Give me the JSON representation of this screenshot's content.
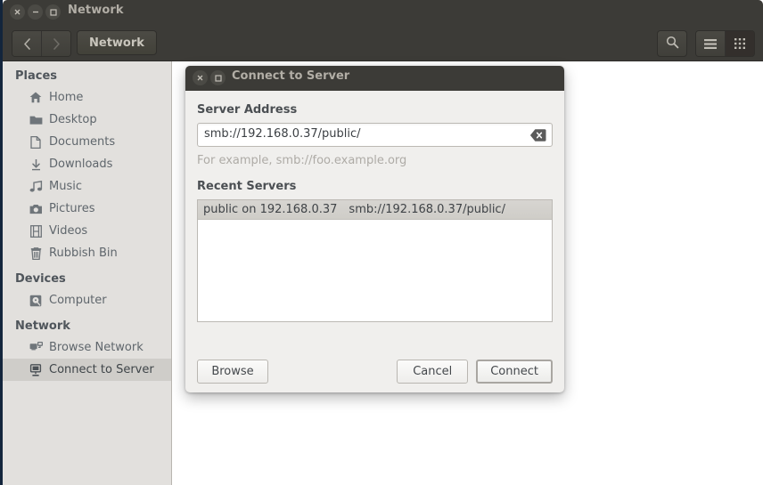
{
  "window": {
    "title": "Network",
    "controls": [
      {
        "name": "close",
        "glyph": "close-icon"
      },
      {
        "name": "minimize",
        "glyph": "minimize-icon"
      },
      {
        "name": "maximize",
        "glyph": "maximize-icon"
      }
    ]
  },
  "toolbar": {
    "back_label": "Back",
    "forward_label": "Forward",
    "breadcrumb": "Network",
    "search_label": "Search",
    "list_view_label": "List view",
    "grid_view_label": "Icon view"
  },
  "sidebar": {
    "sections": [
      {
        "heading": "Places",
        "items": [
          {
            "label": "Home",
            "icon": "home-icon",
            "selected": false
          },
          {
            "label": "Desktop",
            "icon": "folder-icon",
            "selected": false
          },
          {
            "label": "Documents",
            "icon": "document-icon",
            "selected": false
          },
          {
            "label": "Downloads",
            "icon": "download-icon",
            "selected": false
          },
          {
            "label": "Music",
            "icon": "music-icon",
            "selected": false
          },
          {
            "label": "Pictures",
            "icon": "camera-icon",
            "selected": false
          },
          {
            "label": "Videos",
            "icon": "film-icon",
            "selected": false
          },
          {
            "label": "Rubbish Bin",
            "icon": "trash-icon",
            "selected": false
          }
        ]
      },
      {
        "heading": "Devices",
        "items": [
          {
            "label": "Computer",
            "icon": "computer-disk-icon",
            "selected": false
          }
        ]
      },
      {
        "heading": "Network",
        "items": [
          {
            "label": "Browse Network",
            "icon": "network-browse-icon",
            "selected": false
          },
          {
            "label": "Connect to Server",
            "icon": "server-icon",
            "selected": true
          }
        ]
      }
    ]
  },
  "dialog": {
    "title": "Connect to Server",
    "server_address_label": "Server Address",
    "server_address_value": "smb://192.168.0.37/public/",
    "server_address_placeholder": "smb://foo.example.org",
    "hint": "For example, smb://foo.example.org",
    "recent_servers_label": "Recent Servers",
    "recent_servers": [
      {
        "name": "public on 192.168.0.37",
        "uri": "smb://192.168.0.37/public/",
        "selected": true
      }
    ],
    "browse_label": "Browse",
    "cancel_label": "Cancel",
    "connect_label": "Connect",
    "clear_icon": "clear-text-icon"
  },
  "colors": {
    "chrome": "#3c3b37",
    "sidebar": "#e2e0dd",
    "dialog_body": "#f0efed",
    "selection": "#cfcdc9",
    "content": "#ffffff"
  }
}
